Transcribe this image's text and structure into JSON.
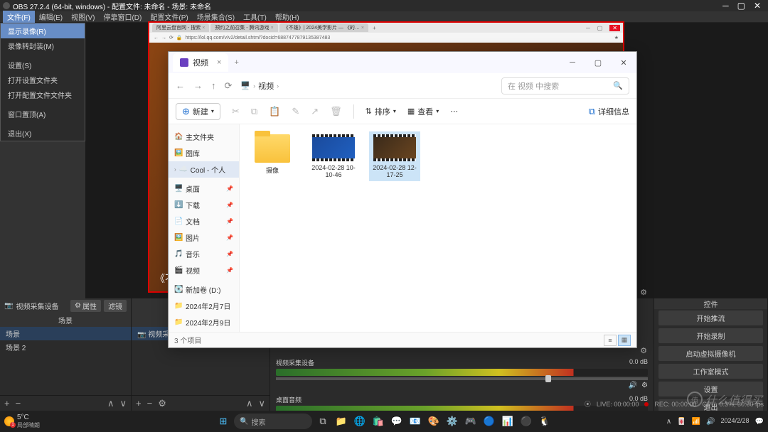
{
  "obs": {
    "title": "OBS 27.2.4 (64-bit, windows) - 配置文件: 未命名 - 场景: 未命名",
    "menu": [
      "文件(F)",
      "编辑(E)",
      "视图(V)",
      "停靠窗口(D)",
      "配置文件(P)",
      "场景集合(S)",
      "工具(T)",
      "帮助(H)"
    ],
    "dropdown": [
      "显示录像(R)",
      "录像转封装(M)",
      "设置(S)",
      "打开设置文件夹",
      "打开配置文件文件夹",
      "窗口置顶(A)",
      "退出(X)"
    ],
    "scenes": {
      "title": "场景",
      "items": [
        "场景",
        "场景 2"
      ]
    },
    "sources": {
      "header": "视频采集设备",
      "properties": "属性",
      "filters": "滤镜",
      "items": [
        "视频采…"
      ]
    },
    "mixer": {
      "ch": [
        {
          "name": "视频采集设备",
          "db": "0.0 dB"
        },
        {
          "name": "桌面音频",
          "db": "0.0 dB"
        }
      ]
    },
    "controls": {
      "title": "控件",
      "btns": [
        "开始推流",
        "开始录制",
        "启动虚拟摄像机",
        "工作室模式",
        "设置",
        "退出"
      ]
    },
    "status": {
      "live": "LIVE: 00:00:00",
      "rec": "REC: 00:00:00",
      "cpu": "CPU: 0.3%, 30.00 fps"
    }
  },
  "browser": {
    "tabs": [
      "阿里云盘官网 - 搜索",
      "预约之前召集 - 腾讯游戏",
      "《不雄》| 2024美学影片 — 《的…"
    ],
    "url": "https://lol.qq.com/v/v2/detail.shtml?docid=6887477879135387483",
    "movie": "《不"
  },
  "explorer": {
    "tab": "视频",
    "crumbs": [
      "视频"
    ],
    "searchPlaceholder": "在 视频 中搜索",
    "toolbar": {
      "new": "新建",
      "sort": "排序",
      "view": "查看",
      "details": "详细信息"
    },
    "nav": {
      "top": [
        {
          "i": "🏠",
          "t": "主文件夹"
        },
        {
          "i": "🖼️",
          "t": "图库"
        },
        {
          "i": "☁️",
          "t": "Cool - 个人",
          "sel": true
        }
      ],
      "pins": [
        {
          "i": "🖥️",
          "t": "桌面"
        },
        {
          "i": "⬇️",
          "t": "下载"
        },
        {
          "i": "📄",
          "t": "文档"
        },
        {
          "i": "🖼️",
          "t": "图片"
        },
        {
          "i": "🎵",
          "t": "音乐"
        },
        {
          "i": "🎬",
          "t": "视频"
        }
      ],
      "drives": [
        {
          "i": "💽",
          "t": "新加卷 (D:)"
        },
        {
          "i": "📁",
          "t": "2024年2月7日"
        },
        {
          "i": "📁",
          "t": "2024年2月9日"
        }
      ]
    },
    "files": [
      {
        "type": "folder",
        "name": "摄像"
      },
      {
        "type": "video",
        "name": "2024-02-28 10-10-46",
        "v": "v1"
      },
      {
        "type": "video",
        "name": "2024-02-28 12-17-25",
        "v": "v2",
        "sel": true
      }
    ],
    "status": "3 个项目"
  },
  "taskbar": {
    "temp": "5°C",
    "cond": "局部晴朗",
    "search": "搜索",
    "date": "2024/2/28"
  },
  "watermark": "什么值得买"
}
